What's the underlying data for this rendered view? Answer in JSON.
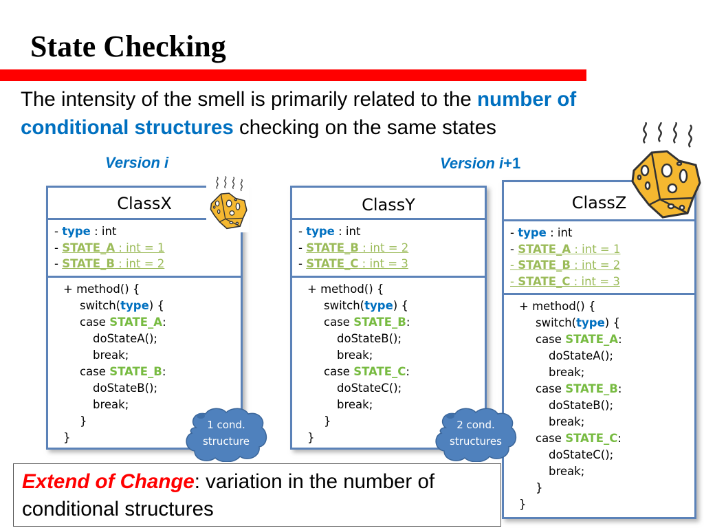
{
  "slide": {
    "title": "State Checking",
    "accent_color": "#ff0000",
    "intro": {
      "part1": "The intensity of the smell is primarily related to the ",
      "highlight": "number of conditional structures",
      "part2": " checking on the same states"
    },
    "versions": {
      "left": "Version i",
      "right_italic": "Version i",
      "right_suffix": "+1"
    }
  },
  "classes": {
    "x": {
      "name": "ClassX",
      "attrs": [
        {
          "prefix": "- ",
          "name": "type",
          "type": " : int"
        },
        {
          "prefix": "- ",
          "name": "STATE_A",
          "type": " : int = 1"
        },
        {
          "prefix": "- ",
          "name": "STATE_B",
          "type": " : int = 2"
        }
      ],
      "method_signature": "+ method() {",
      "switch_open": "switch(",
      "switch_var": "type",
      "switch_close": ") {",
      "cases": [
        {
          "kw": "case ",
          "state": "STATE_A",
          "colon": ":",
          "call": "doStateA();",
          "brk": "break;"
        },
        {
          "kw": "case ",
          "state": "STATE_B",
          "colon": ":",
          "call": "doStateB();",
          "brk": "break;"
        }
      ],
      "close_inner": "}",
      "close_outer": "}"
    },
    "y": {
      "name": "ClassY",
      "attrs": [
        {
          "prefix": "- ",
          "name": "type",
          "type": " : int"
        },
        {
          "prefix": "- ",
          "name": "STATE_B",
          "type": " : int = 2"
        },
        {
          "prefix": "- ",
          "name": "STATE_C",
          "type": " : int = 3"
        }
      ],
      "method_signature": "+ method() {",
      "switch_open": "switch(",
      "switch_var": "type",
      "switch_close": ") {",
      "cases": [
        {
          "kw": "case ",
          "state": "STATE_B",
          "colon": ":",
          "call": "doStateB();",
          "brk": "break;"
        },
        {
          "kw": "case ",
          "state": "STATE_C",
          "colon": ":",
          "call": "doStateC();",
          "brk": "break;"
        }
      ],
      "close_inner": "}",
      "close_outer": "}"
    },
    "z": {
      "name": "ClassZ",
      "attrs": [
        {
          "prefix": "- ",
          "name": "type",
          "type": " : int"
        },
        {
          "prefix": "- ",
          "name": "STATE_A",
          "type": " : int = 1"
        },
        {
          "prefix": "- ",
          "name": "STATE_B",
          "type": " : int = 2"
        },
        {
          "prefix": "- ",
          "name": "STATE_C",
          "type": " : int = 3"
        }
      ],
      "method_signature": "+ method() {",
      "switch_open": "switch(",
      "switch_var": "type",
      "switch_close": ") {",
      "cases": [
        {
          "kw": "case ",
          "state": "STATE_A",
          "colon": ":",
          "call": "doStateA();",
          "brk": "break;"
        },
        {
          "kw": "case ",
          "state": "STATE_B",
          "colon": ":",
          "call": "doStateB();",
          "brk": "break;"
        },
        {
          "kw": "case ",
          "state": "STATE_C",
          "colon": ":",
          "call": "doStateC();",
          "brk": "break;"
        }
      ],
      "close_inner": "}",
      "close_outer": "}"
    }
  },
  "callouts": {
    "one": {
      "line1": "1 cond.",
      "line2": "structure"
    },
    "two": {
      "line1": "2 cond.",
      "line2": "structures"
    }
  },
  "icons": {
    "small_cheese": "smelly-cheese-icon",
    "large_cheese": "smelly-cheese-icon"
  },
  "extend": {
    "term": "Extend of Change",
    "colon": ":",
    "text": " variation in the number of conditional structures"
  },
  "colors": {
    "highlight_blue": "#0070c0",
    "state_green": "#9bbb59",
    "case_green": "#77bb41",
    "box_border": "#5b82b8",
    "cloud_fill": "#4f81bd",
    "cheese": "#f5b830"
  }
}
